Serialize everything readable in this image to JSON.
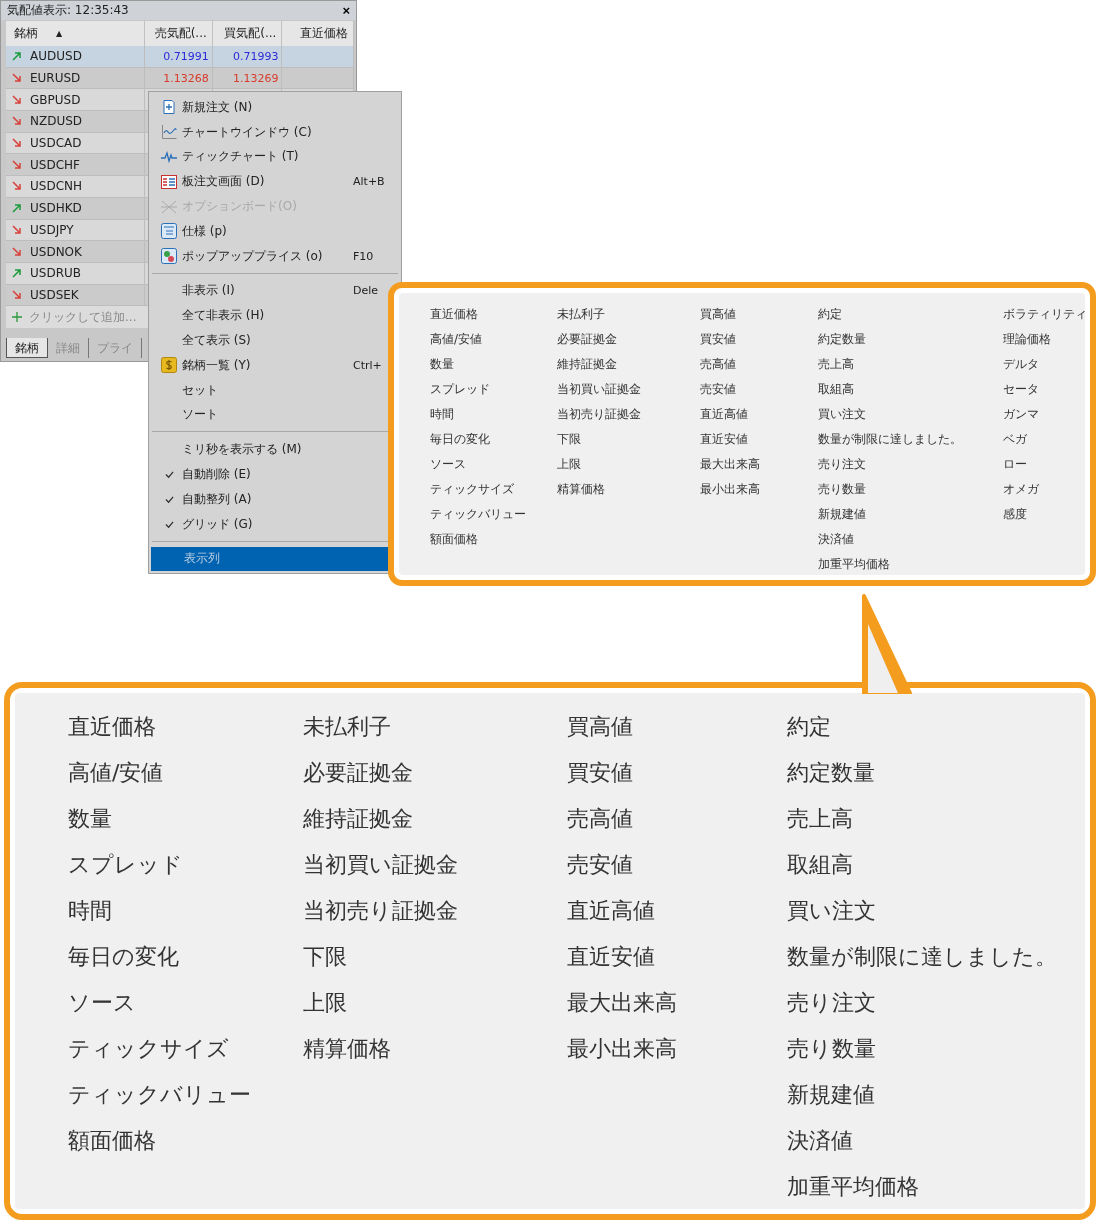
{
  "window": {
    "title": "気配値表示: 12:35:43",
    "close": "×"
  },
  "table": {
    "columns": [
      {
        "label": "銘柄",
        "sort_mark": "▲"
      },
      {
        "label": "売気配(..."
      },
      {
        "label": "買気配(..."
      },
      {
        "label": "直近価格"
      }
    ],
    "rows": [
      {
        "symbol": "AUDUSD",
        "rising": true,
        "bid": "0.71991",
        "ask": "0.71993",
        "selected": true
      },
      {
        "symbol": "EURUSD",
        "rising": false,
        "bid": "1.13268",
        "ask": "1.13269",
        "selected": false
      },
      {
        "symbol": "GBPUSD",
        "rising": false,
        "selected": false
      },
      {
        "symbol": "NZDUSD",
        "rising": false,
        "selected": false
      },
      {
        "symbol": "USDCAD",
        "rising": false,
        "selected": false
      },
      {
        "symbol": "USDCHF",
        "rising": false,
        "selected": false
      },
      {
        "symbol": "USDCNH",
        "rising": false,
        "selected": false
      },
      {
        "symbol": "USDHKD",
        "rising": true,
        "selected": false
      },
      {
        "symbol": "USDJPY",
        "rising": false,
        "selected": false
      },
      {
        "symbol": "USDNOK",
        "rising": false,
        "selected": false
      },
      {
        "symbol": "USDRUB",
        "rising": true,
        "selected": false
      },
      {
        "symbol": "USDSEK",
        "rising": false,
        "selected": false
      }
    ],
    "add_row": "クリックして追加..."
  },
  "tabs": [
    {
      "label": "銘柄",
      "selected": true
    },
    {
      "label": "詳細",
      "selected": false
    },
    {
      "label": "プライ",
      "selected": false
    }
  ],
  "context_menu": {
    "sections": [
      {
        "items": [
          {
            "label": "新規注文 (N)",
            "checked": false,
            "disabled": false,
            "selected": false
          },
          {
            "label": "チャートウインドウ (C)",
            "checked": false,
            "disabled": false,
            "selected": false
          },
          {
            "label": "ティックチャート (T)",
            "checked": false,
            "disabled": false,
            "selected": false
          },
          {
            "label": "板注文画面 (D)",
            "shortcut": "Alt+B",
            "checked": false,
            "disabled": false,
            "selected": false
          },
          {
            "label": "オプションボード(O)",
            "checked": false,
            "disabled": true,
            "selected": false
          },
          {
            "label": "仕様 (p)",
            "checked": false,
            "disabled": false,
            "selected": false
          },
          {
            "label": "ポップアッププライス (o)",
            "shortcut": "F10",
            "checked": false,
            "disabled": false,
            "selected": false
          }
        ]
      },
      {
        "items": [
          {
            "label": "非表示 (I)",
            "shortcut": "Dele",
            "checked": false,
            "disabled": false,
            "selected": false
          },
          {
            "label": "全て非表示 (H)",
            "checked": false,
            "disabled": false,
            "selected": false
          },
          {
            "label": "全て表示 (S)",
            "checked": false,
            "disabled": false,
            "selected": false
          },
          {
            "label": "銘柄一覧 (Y)",
            "shortcut": "Ctrl+",
            "checked": false,
            "disabled": false,
            "selected": false
          },
          {
            "label": "セット",
            "checked": false,
            "disabled": false,
            "selected": false
          },
          {
            "label": "ソート",
            "checked": false,
            "disabled": false,
            "selected": false
          }
        ]
      },
      {
        "items": [
          {
            "label": "ミリ秒を表示する (M)",
            "checked": false,
            "disabled": false,
            "selected": false
          },
          {
            "label": "自動削除 (E)",
            "checked": true,
            "disabled": false,
            "selected": false
          },
          {
            "label": "自動整列 (A)",
            "checked": true,
            "disabled": false,
            "selected": false
          },
          {
            "label": "グリッド (G)",
            "checked": true,
            "disabled": false,
            "selected": false
          }
        ]
      },
      {
        "items": [
          {
            "label": "表示列",
            "checked": false,
            "disabled": false,
            "selected": true
          }
        ]
      }
    ]
  },
  "column_list_small": {
    "columns": [
      {
        "items": [
          "直近価格",
          "高値/安値",
          "数量",
          "スプレッド",
          "時間",
          "毎日の変化",
          "ソース",
          "ティックサイズ",
          "ティックバリュー",
          "額面価格"
        ]
      },
      {
        "items": [
          "未払利子",
          "必要証拠金",
          "維持証拠金",
          "当初買い証拠金",
          "当初売り証拠金",
          "下限",
          "上限",
          "精算価格"
        ]
      },
      {
        "items": [
          "買高値",
          "買安値",
          "売高値",
          "売安値",
          "直近高値",
          "直近安値",
          "最大出来高",
          "最小出来高"
        ]
      },
      {
        "items": [
          "約定",
          "約定数量",
          "売上高",
          "取組高",
          "買い注文",
          "数量が制限に達しました。",
          "売り注文",
          "売り数量",
          "新規建値",
          "決済値",
          "加重平均価格"
        ]
      },
      {
        "items": [
          "ボラティリティ",
          "理論価格",
          "デルタ",
          "セータ",
          "ガンマ",
          "ベガ",
          "ロー",
          "オメガ",
          "感度"
        ]
      }
    ]
  },
  "column_list_large": {
    "columns": [
      {
        "items": [
          "直近価格",
          "高値/安値",
          "数量",
          "スプレッド",
          "時間",
          "毎日の変化",
          "ソース",
          "ティックサイズ",
          "ティックバリュー",
          "額面価格"
        ]
      },
      {
        "items": [
          "未払利子",
          "必要証拠金",
          "維持証拠金",
          "当初買い証拠金",
          "当初売り証拠金",
          "下限",
          "上限",
          "精算価格"
        ]
      },
      {
        "items": [
          "買高値",
          "買安値",
          "売高値",
          "売安値",
          "直近高値",
          "直近安値",
          "最大出来高",
          "最小出来高"
        ]
      },
      {
        "items": [
          "約定",
          "約定数量",
          "売上高",
          "取組高",
          "買い注文",
          "数量が制限に達しました。",
          "売り注文",
          "売り数量",
          "新規建値",
          "決済値",
          "加重平均価格"
        ]
      }
    ]
  }
}
